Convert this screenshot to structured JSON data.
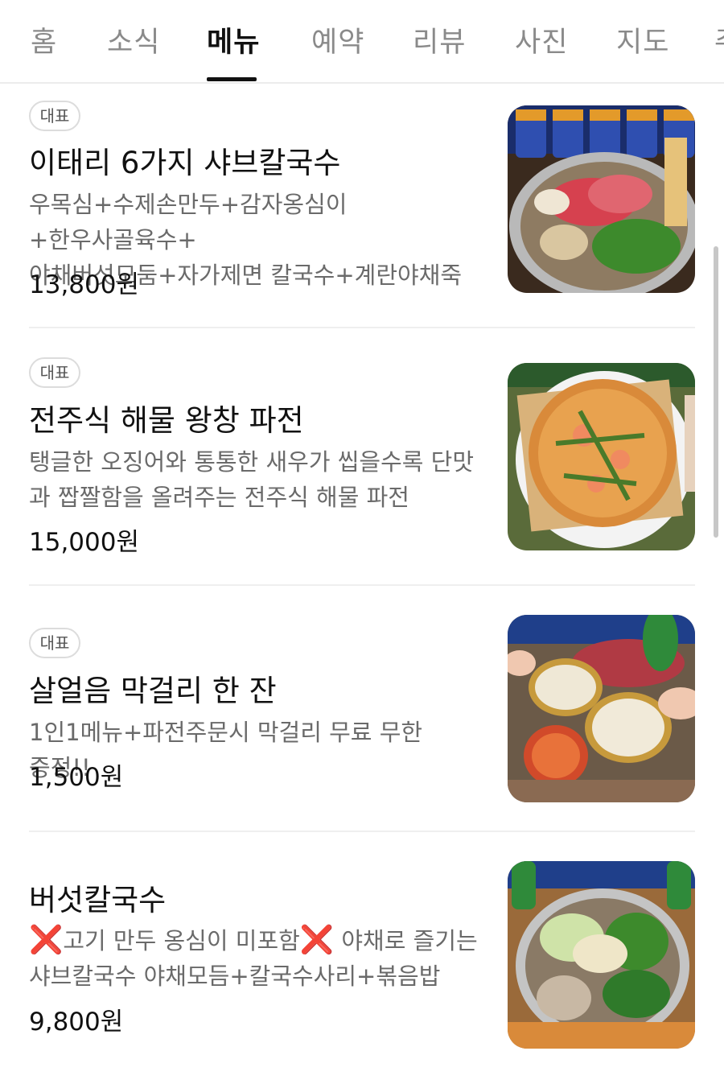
{
  "tabs": [
    {
      "label": "홈"
    },
    {
      "label": "소식"
    },
    {
      "label": "메뉴",
      "active": true
    },
    {
      "label": "예약"
    },
    {
      "label": "리뷰"
    },
    {
      "label": "사진"
    },
    {
      "label": "지도"
    },
    {
      "label": "주"
    }
  ],
  "menu": {
    "items": [
      {
        "badge": "대표",
        "name": "이태리 6가지 샤브칼국수",
        "desc_line1": "우목심+수제손만두+감자옹심이+한우사골육수+",
        "desc_line2": "야채버섯모둠+자가제면 칼국수+계란야채죽",
        "price": "13,800원"
      },
      {
        "badge": "대표",
        "name": "전주식 해물 왕창 파전",
        "desc_line1": "탱글한 오징어와 통통한 새우가 씹을수록 단맛",
        "desc_line2": "과 짭짤함을 올려주는 전주식 해물 파전",
        "price": "15,000원"
      },
      {
        "badge": "대표",
        "name": "살얼음 막걸리 한 잔",
        "desc_line1": "1인1메뉴+파전주문시 막걸리 무료 무한 증정!!",
        "price": "1,500원"
      },
      {
        "name": "버섯칼국수",
        "desc_mark": "❌",
        "desc_part1": "고기 만두 옹심이 미포함",
        "desc_part2": " 야채로 즐기는",
        "desc_line2": "샤브칼국수 야채모듬+칼국수사리+볶음밥",
        "price": "9,800원"
      }
    ]
  }
}
